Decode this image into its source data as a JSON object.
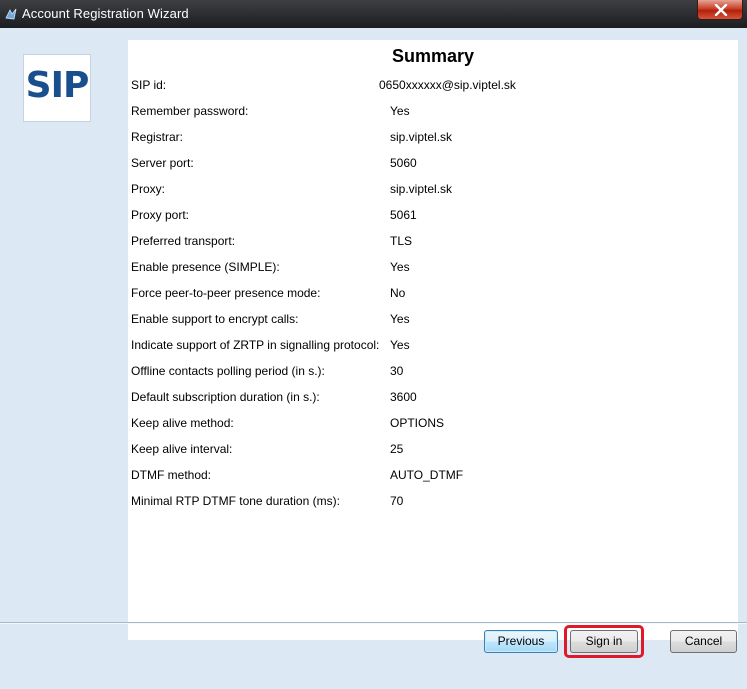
{
  "window": {
    "title": "Account Registration Wizard"
  },
  "logo": {
    "text": "SIP"
  },
  "summary": {
    "title": "Summary",
    "rows": [
      {
        "label": "SIP id:",
        "value": "0650xxxxxx@sip.viptel.sk"
      },
      {
        "label": "Remember password:",
        "value": "Yes"
      },
      {
        "label": "Registrar:",
        "value": "sip.viptel.sk"
      },
      {
        "label": "Server port:",
        "value": "5060"
      },
      {
        "label": "Proxy:",
        "value": "sip.viptel.sk"
      },
      {
        "label": "Proxy port:",
        "value": "5061"
      },
      {
        "label": "Preferred transport:",
        "value": "TLS"
      },
      {
        "label": "Enable presence (SIMPLE):",
        "value": "Yes"
      },
      {
        "label": "Force peer-to-peer presence mode:",
        "value": "No"
      },
      {
        "label": "Enable support to encrypt calls:",
        "value": "Yes"
      },
      {
        "label": "Indicate support of ZRTP in signalling protocol:",
        "value": "Yes"
      },
      {
        "label": "Offline contacts polling period (in s.):",
        "value": "30"
      },
      {
        "label": "Default subscription duration (in s.):",
        "value": "3600"
      },
      {
        "label": "Keep alive method:",
        "value": "OPTIONS"
      },
      {
        "label": "Keep alive interval:",
        "value": "25"
      },
      {
        "label": "DTMF method:",
        "value": "AUTO_DTMF"
      },
      {
        "label": "Minimal RTP DTMF tone duration (ms):",
        "value": "70"
      }
    ]
  },
  "buttons": {
    "previous": "Previous",
    "signin": "Sign in",
    "cancel": "Cancel"
  },
  "colors": {
    "highlight": "#e0192a",
    "logo": "#1a4f8e"
  }
}
